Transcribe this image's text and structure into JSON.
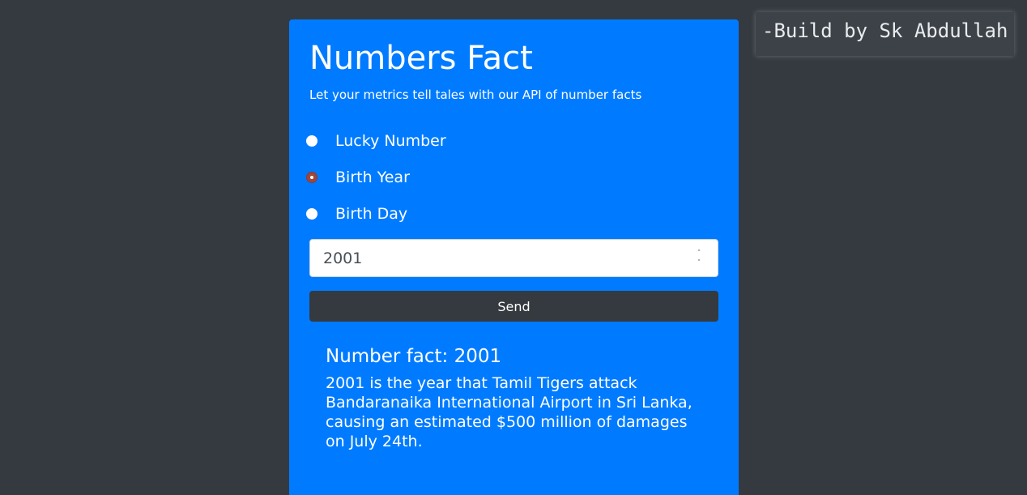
{
  "card": {
    "title": "Numbers Fact",
    "subtitle": "Let your metrics tell tales with our API of number facts",
    "options": [
      {
        "label": "Lucky Number",
        "checked": false
      },
      {
        "label": "Birth Year",
        "checked": true
      },
      {
        "label": "Birth Day",
        "checked": false
      }
    ],
    "input_value": "2001",
    "send_label": "Send",
    "fact_heading": "Number fact: 2001",
    "fact_text": "2001 is the year that Tamil Tigers attack Bandaranaika International Airport in Sri Lanka, causing an estimated $500 million of damages on July 24th."
  },
  "credit": "-Build by Sk Abdullah",
  "colors": {
    "background": "#343a40",
    "card": "#007bff",
    "button": "#343a40",
    "radio_checked": "#a0473d"
  },
  "icons": {
    "spinner_up": "chevron-up-icon",
    "spinner_down": "chevron-down-icon"
  }
}
